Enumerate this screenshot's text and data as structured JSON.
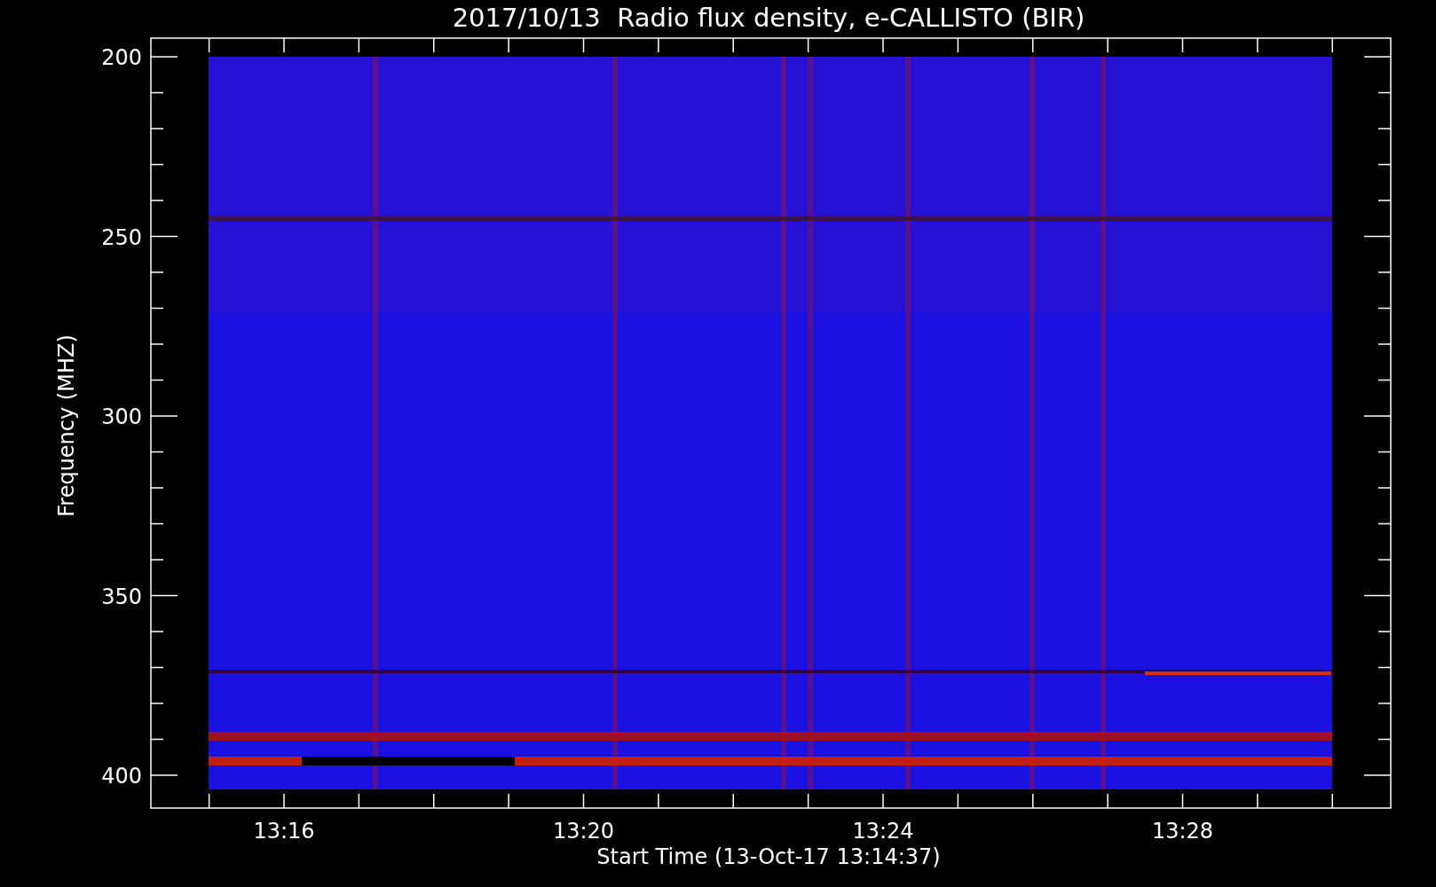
{
  "title": "2017/10/13  Radio flux density, e-CALLISTO (BIR)",
  "y_axis": {
    "label": "Frequency (MHZ)",
    "ticks": [
      "200",
      "250",
      "300",
      "350",
      "400"
    ]
  },
  "x_axis": {
    "label": "Start Time (13-Oct-17 13:14:37)",
    "ticks": [
      "13:16",
      "13:20",
      "13:24",
      "13:28"
    ]
  }
}
